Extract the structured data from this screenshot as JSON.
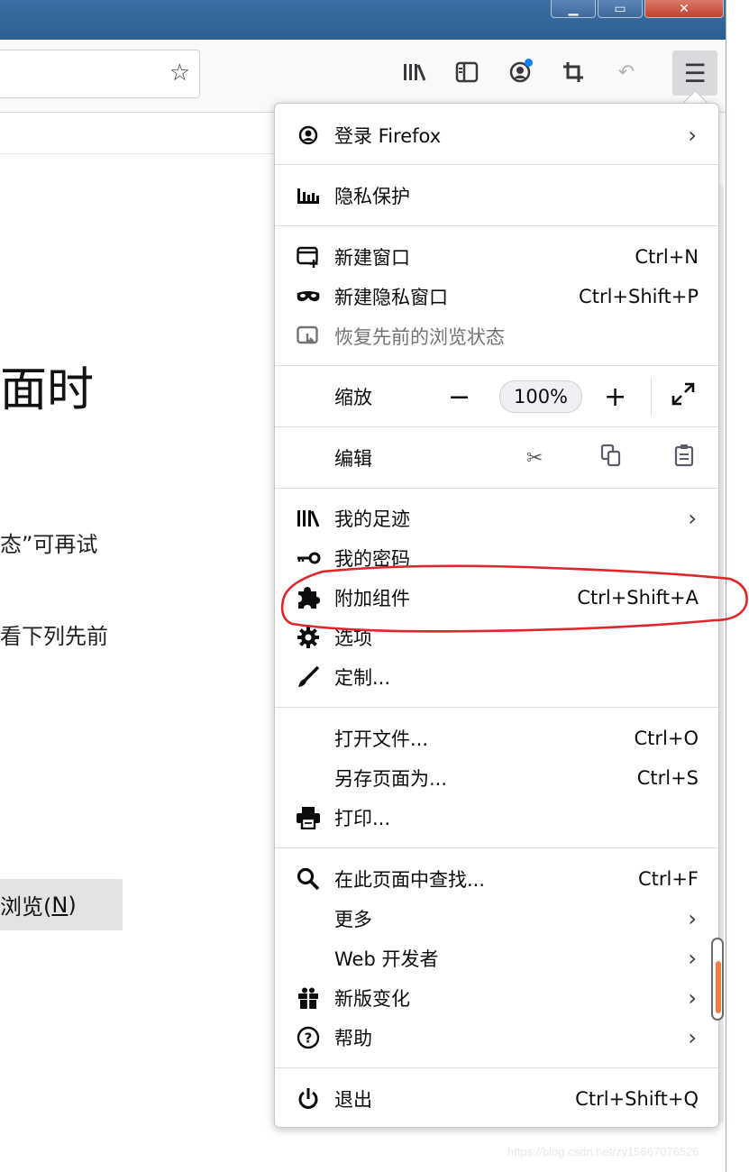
{
  "window": {
    "buttons": [
      "minimize-icon",
      "maximize-icon",
      "close-icon"
    ],
    "accent": "#2d5f93"
  },
  "toolbar": {
    "icons": [
      "library-icon",
      "sidebar-icon",
      "account-icon",
      "screenshot-icon",
      "undo-icon",
      "menu-icon"
    ],
    "star_icon": "bookmark-star-icon",
    "notification_dot_color": "#0a84ff"
  },
  "background_page": {
    "heading_fragment": "面时",
    "line1_fragment": "态”可再试",
    "line2_fragment": "看下列先前",
    "button_text": "浏览(",
    "button_accel": "N",
    "button_close": ")"
  },
  "menu": {
    "signin": {
      "label": "登录 Firefox",
      "icon": "account-icon"
    },
    "privacy": {
      "label": "隐私保护",
      "icon": "chart-icon"
    },
    "new_window": {
      "label": "新建窗口",
      "shortcut": "Ctrl+N",
      "icon": "new-window-icon"
    },
    "new_private": {
      "label": "新建隐私窗口",
      "shortcut": "Ctrl+Shift+P",
      "icon": "mask-icon"
    },
    "restore": {
      "label": "恢复先前的浏览状态",
      "icon": "restore-icon",
      "disabled": true
    },
    "zoom": {
      "label": "缩放",
      "minus": "−",
      "value": "100%",
      "plus": "+",
      "fullscreen_icon": "expand-icon"
    },
    "edit": {
      "label": "编辑",
      "icons": [
        "cut-icon",
        "copy-icon",
        "paste-icon"
      ]
    },
    "library": {
      "label": "我的足迹",
      "icon": "library-icon"
    },
    "passwords": {
      "label": "我的密码",
      "icon": "key-icon"
    },
    "addons": {
      "label": "附加组件",
      "shortcut": "Ctrl+Shift+A",
      "icon": "puzzle-icon"
    },
    "options": {
      "label": "选项",
      "icon": "gear-icon"
    },
    "customize": {
      "label": "定制...",
      "icon": "brush-icon"
    },
    "open_file": {
      "label": "打开文件...",
      "shortcut": "Ctrl+O"
    },
    "save_page": {
      "label": "另存页面为...",
      "shortcut": "Ctrl+S"
    },
    "print": {
      "label": "打印...",
      "icon": "printer-icon"
    },
    "find": {
      "label": "在此页面中查找...",
      "shortcut": "Ctrl+F",
      "icon": "search-icon"
    },
    "more": {
      "label": "更多"
    },
    "web_dev": {
      "label": "Web 开发者"
    },
    "whats_new": {
      "label": "新版变化",
      "icon": "gift-icon"
    },
    "help": {
      "label": "帮助",
      "icon": "help-icon"
    },
    "quit": {
      "label": "退出",
      "shortcut": "Ctrl+Shift+Q",
      "icon": "power-icon"
    }
  },
  "annotation": {
    "color": "#e0262b",
    "target": "addons"
  },
  "watermark": "https://blog.csdn.net/zy15667076526"
}
